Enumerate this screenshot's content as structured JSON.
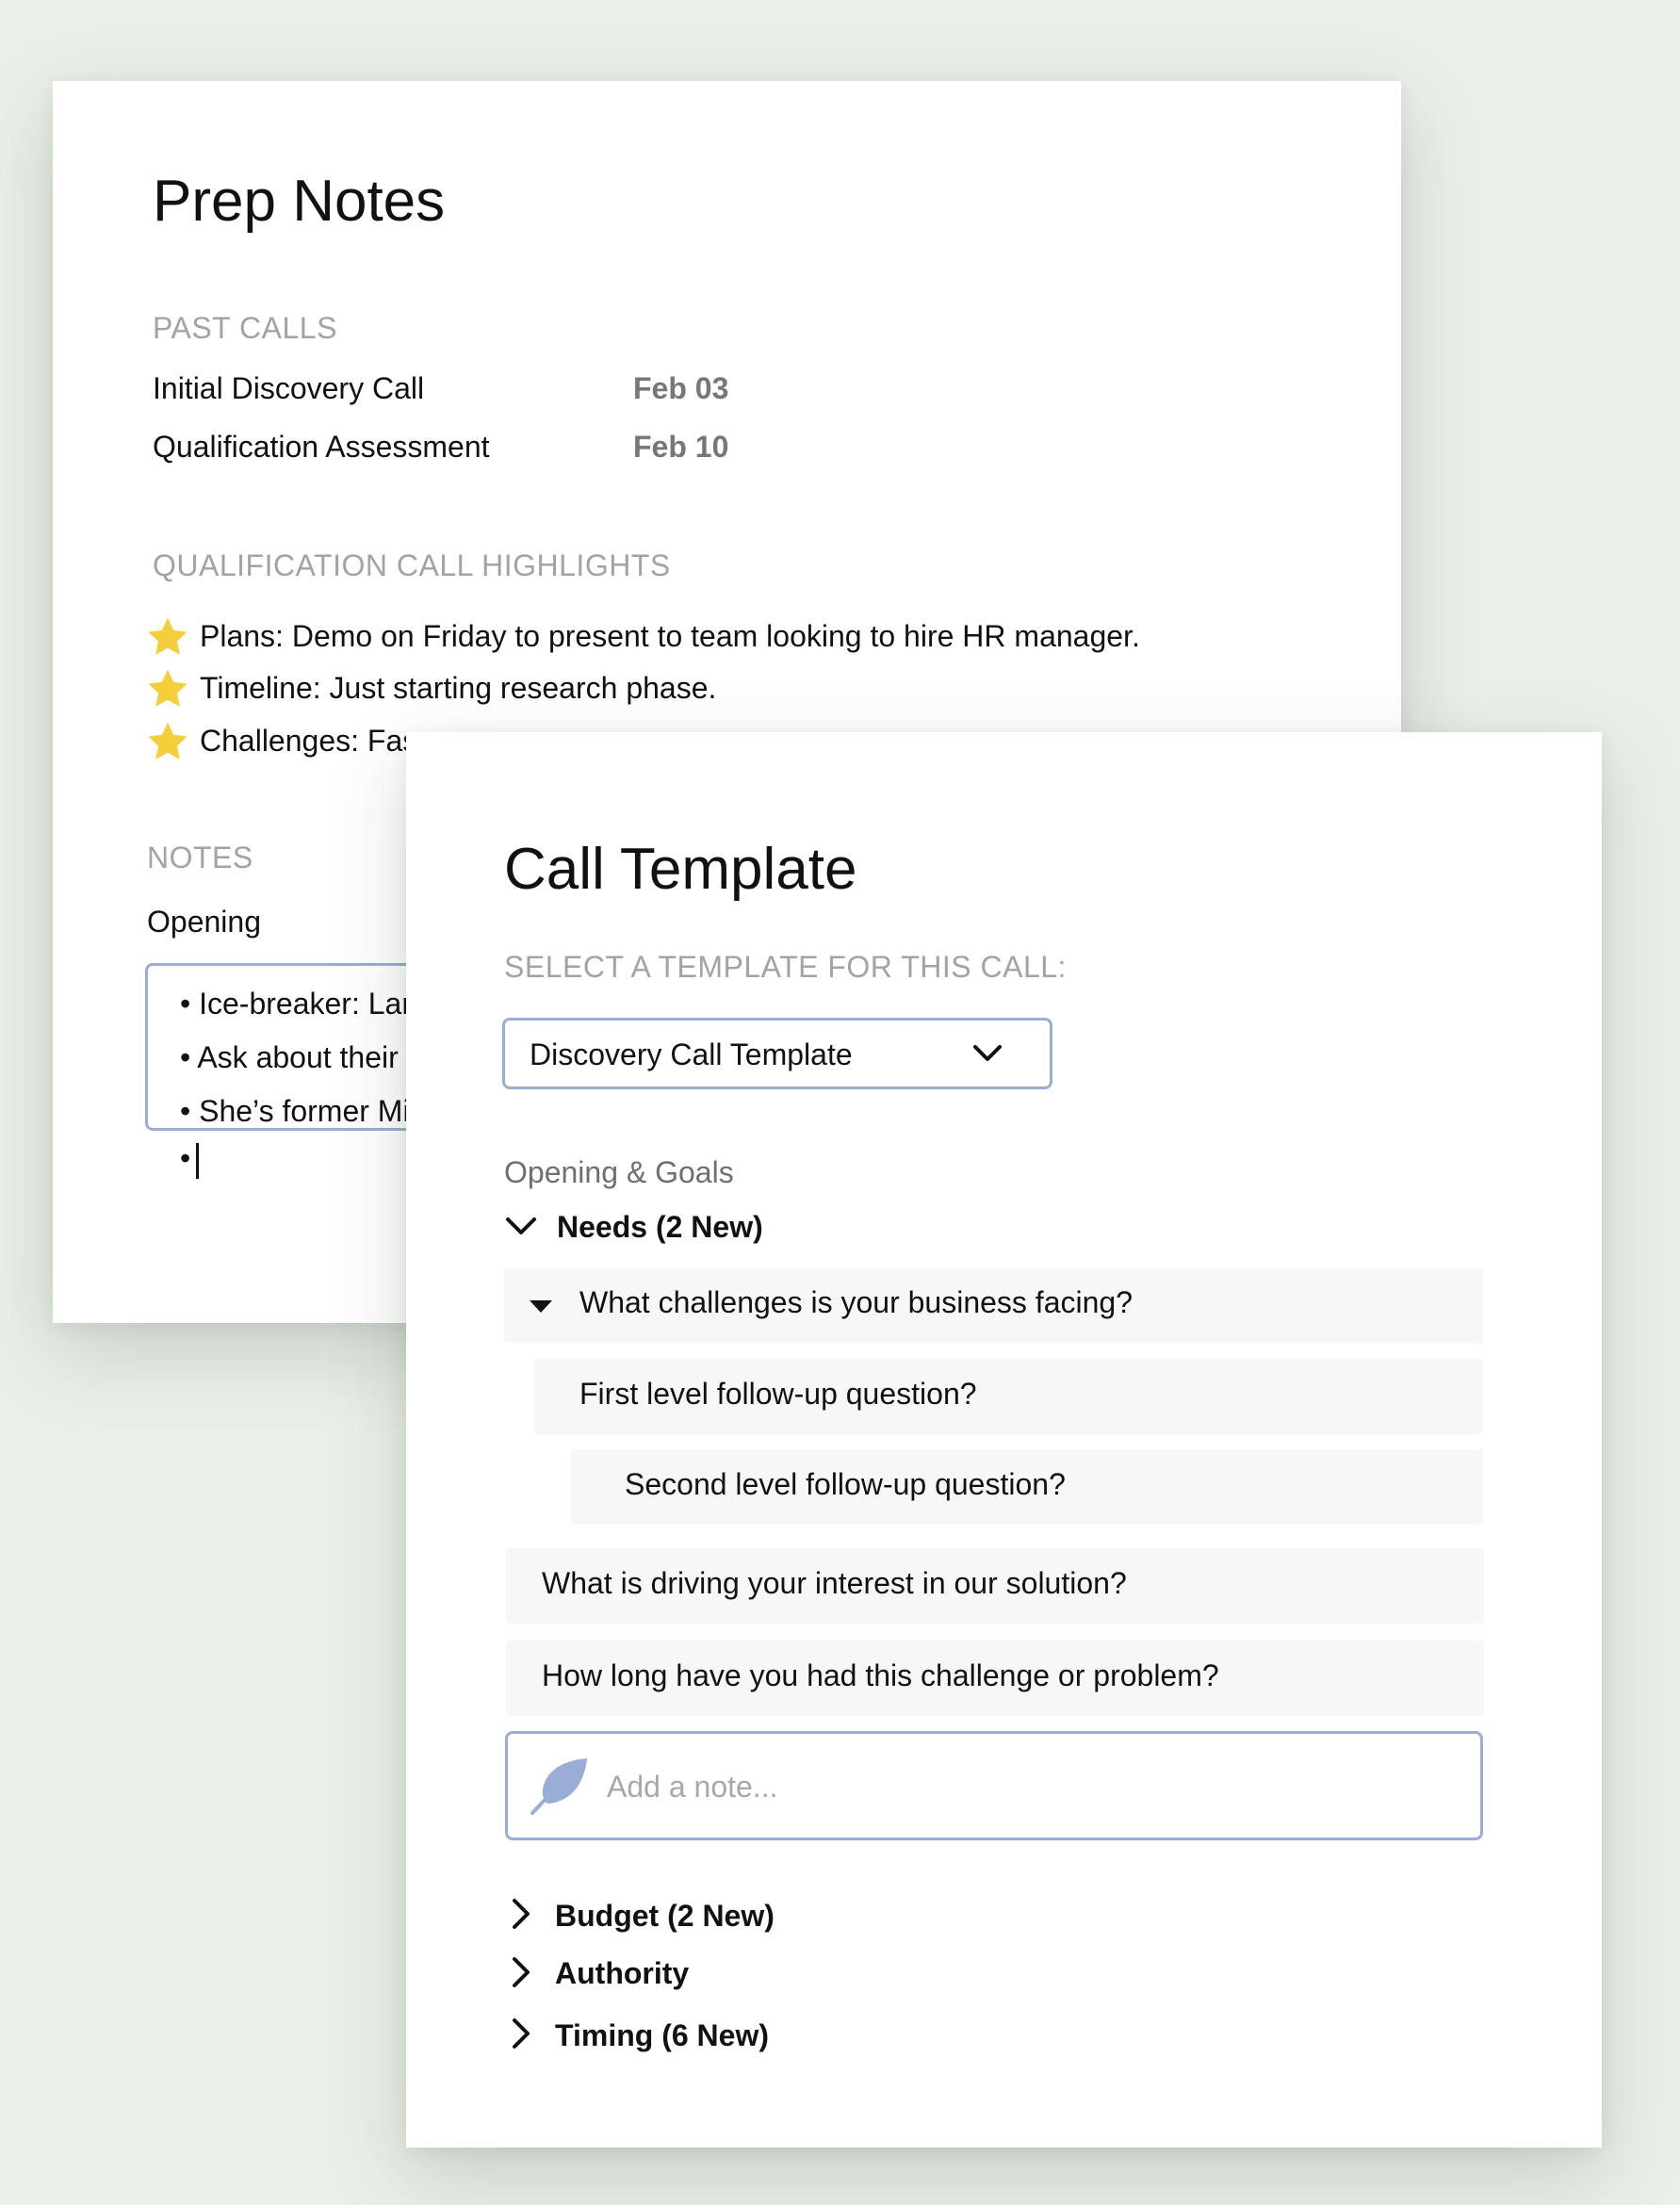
{
  "prep_notes": {
    "title": "Prep Notes",
    "past_calls_label": "PAST CALLS",
    "past_calls": [
      {
        "name": "Initial Discovery Call",
        "date": "Feb 03"
      },
      {
        "name": "Qualification Assessment",
        "date": "Feb 10"
      }
    ],
    "highlights_label": "QUALIFICATION CALL HIGHLIGHTS",
    "highlights": [
      "Plans: Demo on Friday to present to team looking to hire HR manager.",
      "Timeline: Just starting research phase.",
      "Challenges: Fas"
    ],
    "notes_label": "NOTES",
    "notes_heading": "Opening",
    "notes_bullets": [
      "• Ice-breaker: Lar",
      "• Ask about their",
      "• She’s former Mi",
      "•"
    ]
  },
  "call_template": {
    "title": "Call Template",
    "select_label": "SELECT A TEMPLATE FOR THIS CALL:",
    "selected_template": "Discovery Call Template",
    "section_label": "Opening & Goals",
    "groups": [
      {
        "label": "Needs (2 New)",
        "expanded": true
      },
      {
        "label": "Budget (2 New)",
        "expanded": false
      },
      {
        "label": "Authority",
        "expanded": false
      },
      {
        "label": "Timing (6 New)",
        "expanded": false
      }
    ],
    "questions": [
      "What challenges is your business facing?",
      "First level follow-up question?",
      "Second level follow-up question?",
      "What is driving your interest in our solution?",
      "How long have you had this challenge or problem?"
    ],
    "note_placeholder": "Add a note..."
  },
  "colors": {
    "background": "#eaf0e8",
    "accent_border": "#9aadd6",
    "star": "#f3cf3c",
    "row_bg": "#f7f7f7"
  },
  "icons": {
    "star": "star-icon",
    "chevron_down": "chevron-down-icon",
    "chevron_right": "chevron-right-icon",
    "triangle_down": "triangle-down-icon",
    "feather": "feather-icon"
  }
}
